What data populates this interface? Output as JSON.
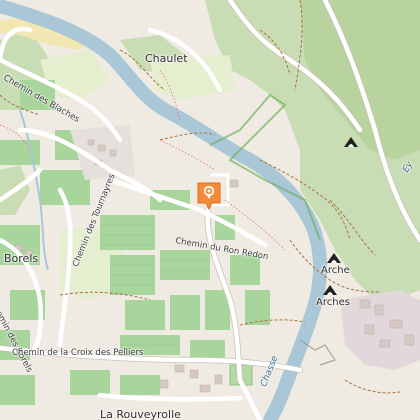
{
  "map": {
    "colors": {
      "land": "#efebe3",
      "forest": "#c9ddb5",
      "forest_dark": "#b3cf98",
      "vineyard": "#a8d59c",
      "field": "#e6eed0",
      "water": "#a9c7d6",
      "sand": "#f2e6b3",
      "residential": "#e2d8dc",
      "road": "#ffffff",
      "road_casing": "#c9c2b7",
      "track": "#a5733d",
      "boundary": "#6fae5a",
      "marker": "#f58a3a"
    },
    "labels": {
      "chaulet": "Chaulet",
      "chemin_blaches": "Chemin des Blaches",
      "chemin_tournayres": "Chemin des Tournayres",
      "chemin_ron_redon": "Chemin du Ron Redon",
      "borels": "Borels",
      "chemin_borels": "Chemin des Borels",
      "chemin_croix_pelliers": "Chemin de la Croix des Pelliers",
      "la_rouveyrolle": "La Rouveyrolle",
      "arche": "Arche",
      "arches": "Arches",
      "chasse": "Chasse",
      "river_right": "Ey"
    },
    "marker": {
      "name": "location-pin",
      "icon": "camera-icon"
    },
    "cave_icons": [
      "cave-icon",
      "cave-icon",
      "cave-icon"
    ]
  }
}
